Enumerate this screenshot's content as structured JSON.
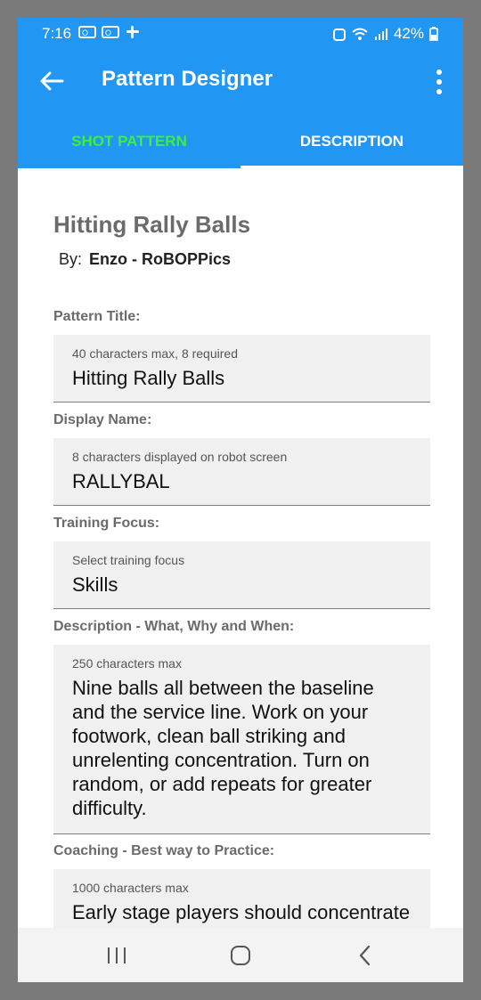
{
  "status_bar": {
    "time": "7:16",
    "battery": "42%",
    "notification_icons": [
      "outlook-icon",
      "outlook-icon",
      "slack-icon"
    ]
  },
  "app_bar": {
    "title": "Pattern Designer"
  },
  "tabs": [
    {
      "label": "SHOT PATTERN",
      "active": true
    },
    {
      "label": "DESCRIPTION",
      "active": false
    }
  ],
  "pattern": {
    "title": "Hitting Rally Balls",
    "by_label": "By:",
    "author": "Enzo - RoBOPPics"
  },
  "fields": {
    "pattern_title": {
      "label": "Pattern Title:",
      "hint": "40 characters max, 8 required",
      "value": "Hitting Rally Balls"
    },
    "display_name": {
      "label": "Display Name:",
      "hint": "8 characters displayed on robot screen",
      "value": "RALLYBAL"
    },
    "training_focus": {
      "label": "Training Focus:",
      "hint": "Select training focus",
      "value": "Skills"
    },
    "description": {
      "label": "Description - What, Why and When:",
      "hint": "250 characters max",
      "value": "Nine balls all between the baseline and the service line. Work on your footwork, clean ball striking and unrelenting concentration. Turn on random, or add repeats for greater difficulty."
    },
    "coaching": {
      "label": "Coaching - Best way to Practice:",
      "hint": "1000 characters max",
      "value": "Early stage players should concentrate on moving their feet to"
    }
  },
  "colors": {
    "primary": "#2196f3",
    "active_tab": "#3cf03c",
    "field_bg": "#f0f0f0"
  }
}
